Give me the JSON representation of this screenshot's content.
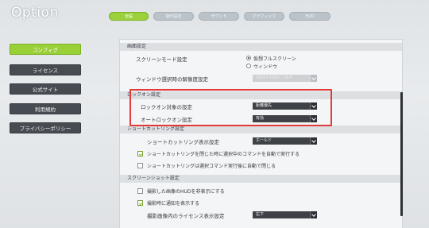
{
  "app": {
    "title": "Option"
  },
  "tabs": [
    {
      "label": "全般",
      "active": true
    },
    {
      "label": "操作設定",
      "active": false
    },
    {
      "label": "サウンド",
      "active": false
    },
    {
      "label": "グラフィック",
      "active": false
    },
    {
      "label": "HUD",
      "active": false
    }
  ],
  "sidebar": {
    "items": [
      {
        "label": "コンフィグ",
        "active": true
      },
      {
        "label": "ライセンス",
        "active": false
      },
      {
        "label": "公式サイト",
        "active": false
      },
      {
        "label": "利用規約",
        "active": false
      },
      {
        "label": "プライバシーポリシー",
        "active": false
      }
    ]
  },
  "sections": {
    "display": {
      "title": "画面設定",
      "screen_mode_label": "スクリーンモード設定",
      "screen_mode_options": [
        {
          "label": "仮想フルスクリーン",
          "selected": true
        },
        {
          "label": "ウィンドウ",
          "selected": false
        }
      ],
      "window_resolution_label": "ウィンドウ選択時の解像度設定",
      "window_resolution_value": "1920×1080 / 16:9"
    },
    "lockon": {
      "title": "ロックオン設定",
      "target_label": "ロックオン対象の設定",
      "target_value": "距離優先",
      "auto_label": "オートロックオン設定",
      "auto_value": "有効"
    },
    "shortcut": {
      "title": "ショートカットリング設定",
      "display_label": "ショートカットリング表示設定",
      "display_value": "ホールド",
      "option1": {
        "label": "ショートカットリングを閉じた時に選択中のコマンドを自動で実行する",
        "checked": true
      },
      "option2": {
        "label": "ショートカットリングは選択コマンド実行後に自動で閉じる",
        "checked": false
      }
    },
    "screenshot": {
      "title": "スクリーンショット設定",
      "option1": {
        "label": "撮影した画像のHUDを非表示にする",
        "checked": false
      },
      "option2": {
        "label": "撮影時に通知を表示する",
        "checked": true
      },
      "license_label": "撮影画像内のライセンス表示設定",
      "license_value": "右下"
    }
  },
  "colors": {
    "accent": "#9bd13b",
    "highlight": "#e23a3a",
    "side_bg": "#474c52"
  }
}
